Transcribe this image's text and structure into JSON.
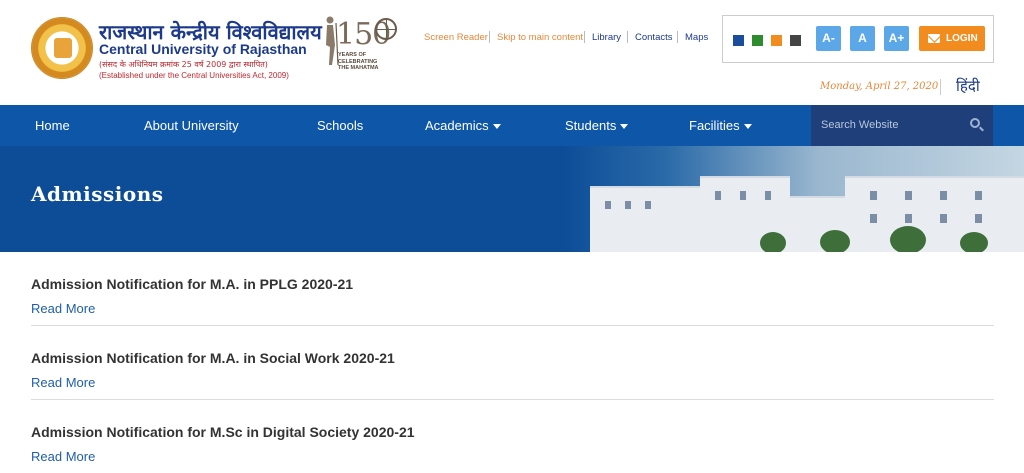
{
  "header": {
    "university_hindi": "राजस्थान केन्द्रीय विश्वविद्यालय",
    "university_english": "Central University of Rajasthan",
    "act_hindi": "(संसद के अधिनियम क्रमांक 25 वर्ष 2009 द्वारा स्थापित)",
    "act_english": "(Established under the Central Universities Act, 2009)",
    "anniversary_number": "150",
    "anniversary_caption": "YEARS OF\nCELEBRATING\nTHE MAHATMA",
    "top_links": [
      "Screen Reader",
      "Skip to main content",
      "Library",
      "Contacts",
      "Maps"
    ],
    "color_swatches": [
      "#1c4d9c",
      "#2e8b2e",
      "#f28c1f",
      "#444444"
    ],
    "font_buttons": [
      "A-",
      "A",
      "A+"
    ],
    "login_label": "LOGIN",
    "date": "Monday, April 27, 2020",
    "language_link": "हिंदी"
  },
  "colors": {
    "primary_blue": "#0e56a8",
    "accent_orange": "#f28c1f",
    "search_bg": "#1f3f7a"
  },
  "nav": {
    "items": [
      {
        "label": "Home",
        "dropdown": false
      },
      {
        "label": "About University",
        "dropdown": false
      },
      {
        "label": "Schools",
        "dropdown": false
      },
      {
        "label": "Academics",
        "dropdown": true
      },
      {
        "label": "Students",
        "dropdown": true
      },
      {
        "label": "Facilities",
        "dropdown": true
      }
    ],
    "search_placeholder": "Search Website"
  },
  "banner": {
    "title": "Admissions"
  },
  "admissions": [
    {
      "title": "Admission Notification for M.A. in PPLG 2020-21",
      "link": "Read More"
    },
    {
      "title": "Admission Notification for M.A. in Social Work 2020-21",
      "link": "Read More"
    },
    {
      "title": "Admission Notification for M.Sc in Digital Society 2020-21",
      "link": "Read More"
    }
  ]
}
